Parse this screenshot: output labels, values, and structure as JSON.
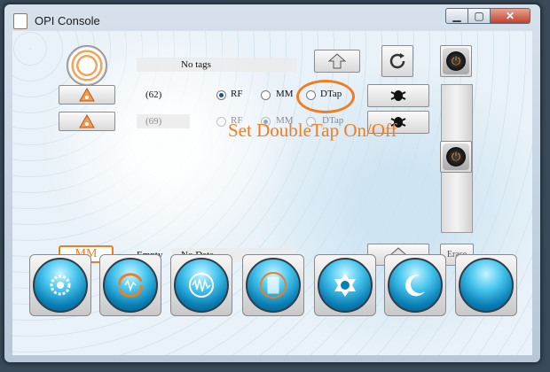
{
  "window": {
    "title": "OPI Console"
  },
  "titlebar": {
    "min_glyph": "▁",
    "max_glyph": "▢",
    "close_glyph": "✕"
  },
  "header": {
    "tag_text": "No tags"
  },
  "row1": {
    "count": "(62)",
    "radio_rf": "RF",
    "radio_mm": "MM",
    "radio_dtap": "DTap",
    "selected": "RF"
  },
  "row2": {
    "count": "(69)",
    "radio_rf": "RF",
    "radio_mm": "MM",
    "radio_dtap": "DTap",
    "selected": "MM"
  },
  "annotation": {
    "text": "Set DoubleTap On/Off",
    "color": "#f07d22"
  },
  "status": {
    "mode_badge": "MM",
    "label": "Empty",
    "value": "No Data",
    "erase_label": "Erase"
  },
  "icons": {
    "upload": "arrow-up-icon",
    "refresh": "refresh-icon",
    "power": "power-icon",
    "bug": "bug-icon",
    "warning": "warning-icon",
    "bottom_buttons": [
      "gear-icon",
      "sync-icon",
      "waveform-icon",
      "document-icon",
      "settings-icon",
      "sleep-icon",
      "blank-orb-icon"
    ]
  },
  "colors": {
    "accent": "#f07d22",
    "orb": "#49c7ef"
  }
}
